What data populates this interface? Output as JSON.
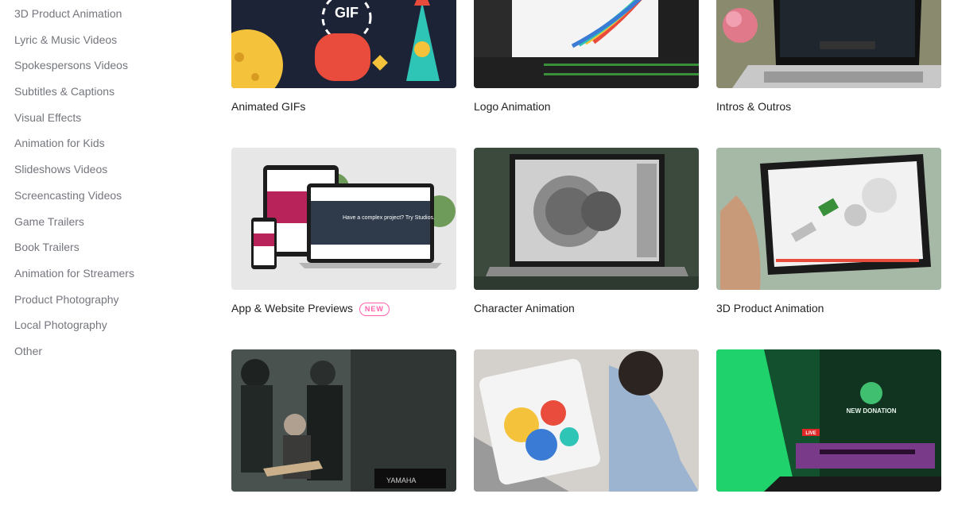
{
  "sidebar": {
    "items": [
      {
        "label": "3D Product Animation"
      },
      {
        "label": "Lyric & Music Videos"
      },
      {
        "label": "Spokespersons Videos"
      },
      {
        "label": "Subtitles & Captions"
      },
      {
        "label": "Visual Effects"
      },
      {
        "label": "Animation for Kids"
      },
      {
        "label": "Slideshows Videos"
      },
      {
        "label": "Screencasting Videos"
      },
      {
        "label": "Game Trailers"
      },
      {
        "label": "Book Trailers"
      },
      {
        "label": "Animation for Streamers"
      },
      {
        "label": "Product Photography"
      },
      {
        "label": "Local Photography"
      },
      {
        "label": "Other"
      }
    ]
  },
  "cards": [
    {
      "label": "Animated GIFs",
      "thumb_text": "GIF"
    },
    {
      "label": "Logo Animation"
    },
    {
      "label": "Intros & Outros"
    },
    {
      "label": "App & Website Previews",
      "badge": "NEW",
      "thumb_text": "Have a complex project? Try Studios."
    },
    {
      "label": "Character Animation"
    },
    {
      "label": "3D Product Animation"
    },
    {
      "label": "",
      "thumb_text": "YAMAHA"
    },
    {
      "label": ""
    },
    {
      "label": "",
      "thumb_text": "NEW DONATION",
      "live_text": "LIVE"
    }
  ],
  "colors": {
    "sidebar_text": "#74767e",
    "card_label": "#222325",
    "new_badge": "#ff62ad",
    "gif_bg": "#1d2336",
    "stream_green": "#1fd26b"
  }
}
